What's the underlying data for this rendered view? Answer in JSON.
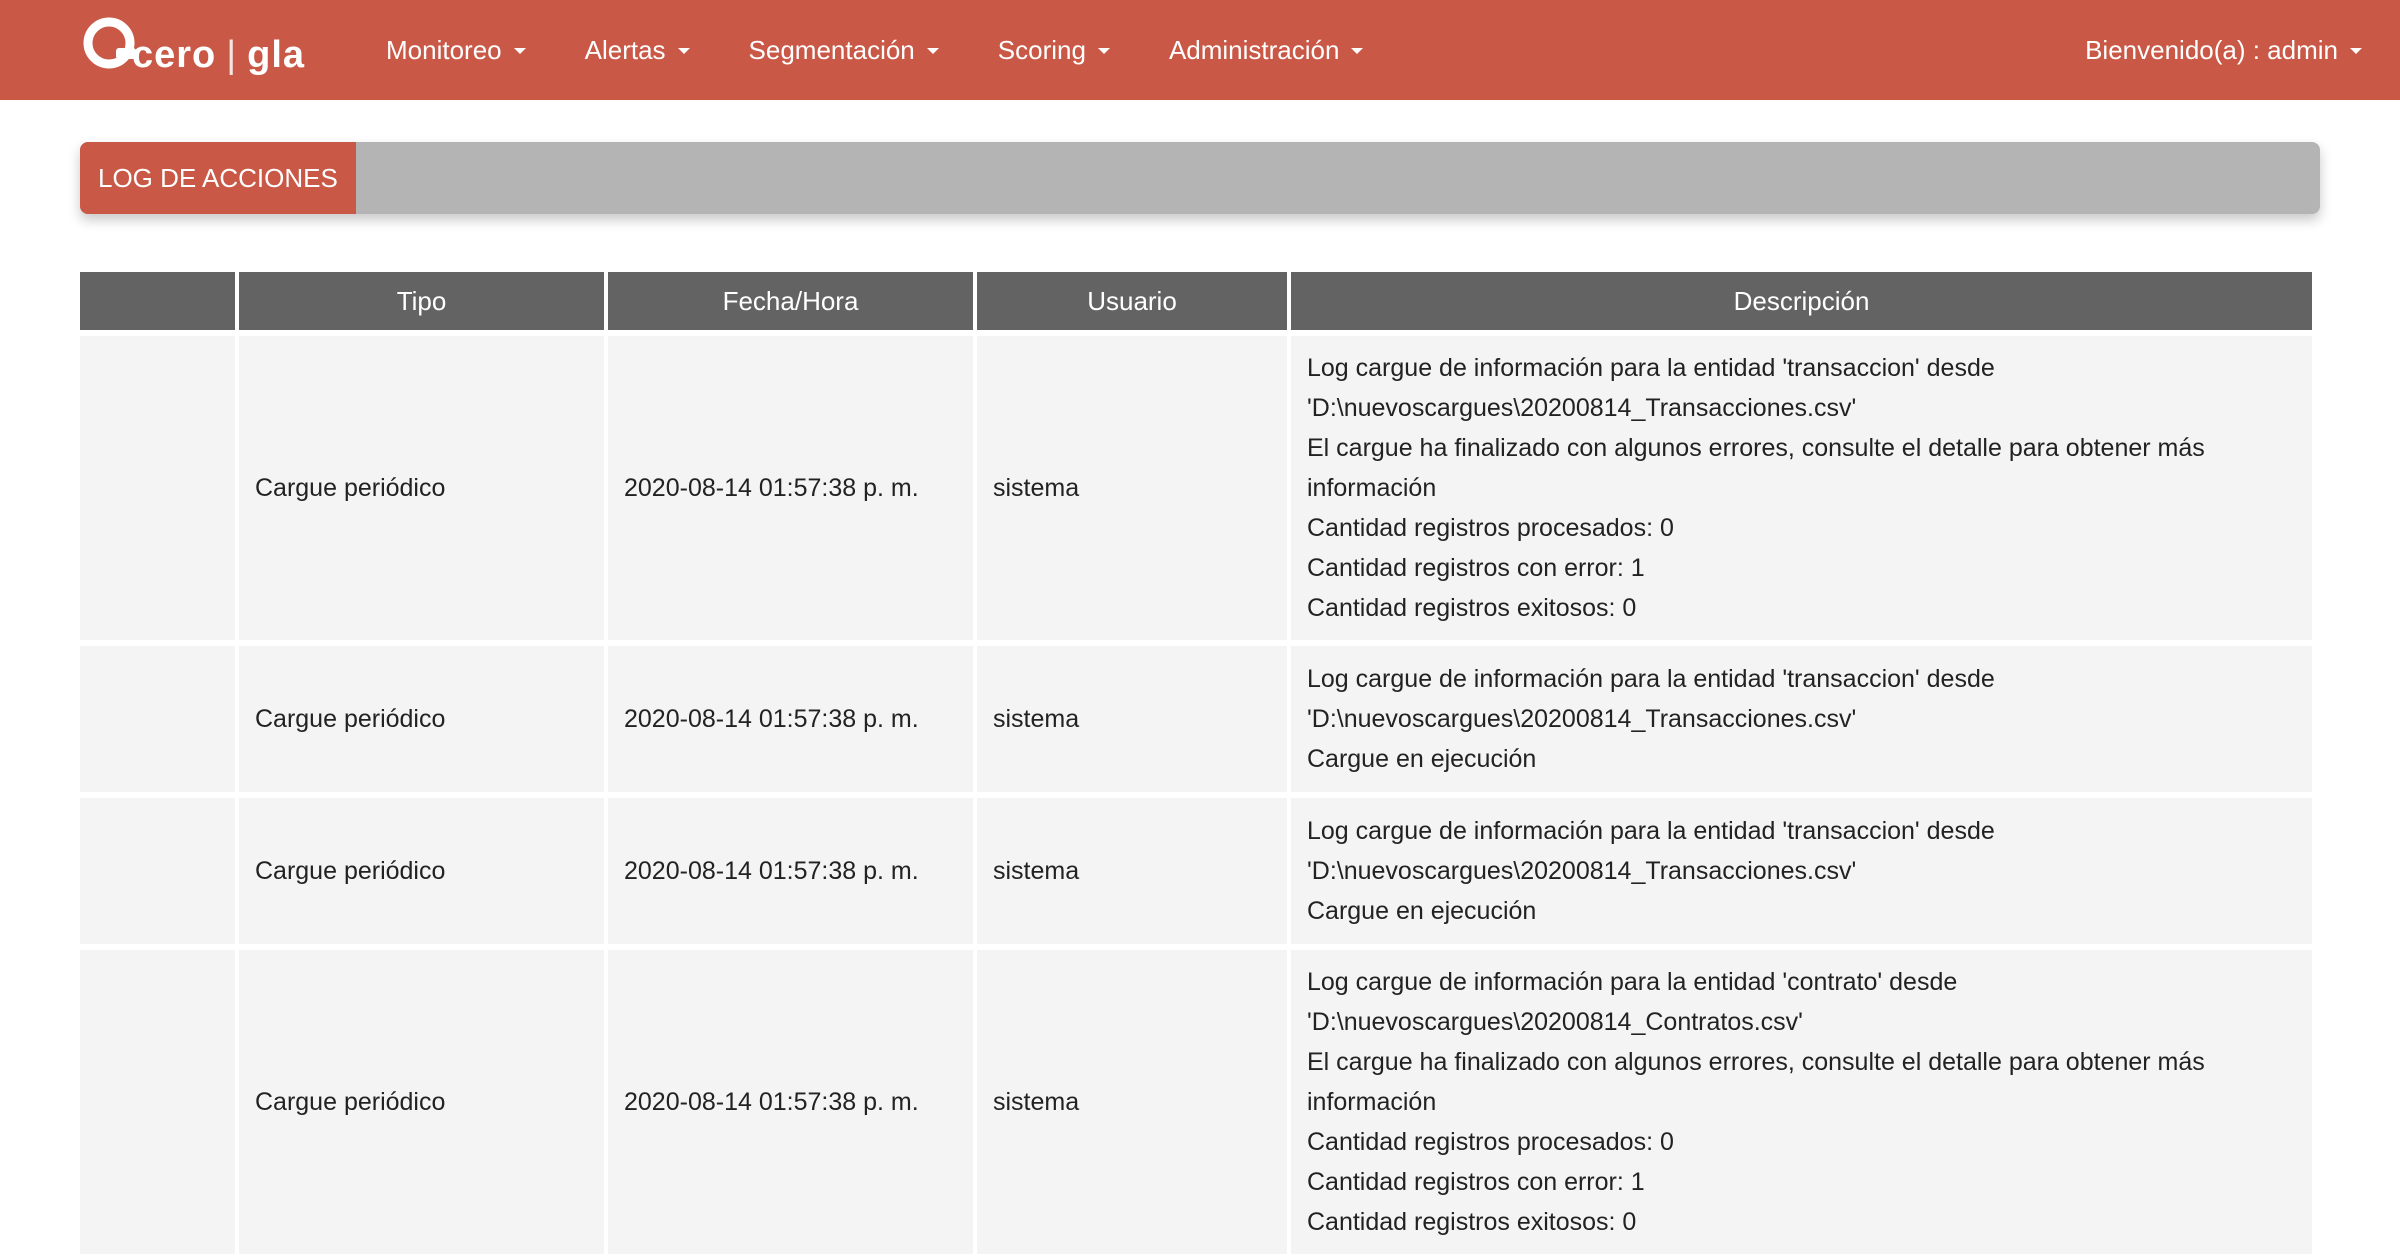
{
  "navbar": {
    "logo_text_a": "cero",
    "logo_sep": "|",
    "logo_text_b": "gla",
    "menu": [
      {
        "label": "Monitoreo"
      },
      {
        "label": "Alertas"
      },
      {
        "label": "Segmentación"
      },
      {
        "label": "Scoring"
      },
      {
        "label": "Administración"
      }
    ],
    "user_label": "Bienvenido(a) : admin",
    "brand_color": "#c95846"
  },
  "page": {
    "title": "LOG DE ACCIONES"
  },
  "table": {
    "columns": [
      "",
      "Tipo",
      "Fecha/Hora",
      "Usuario",
      "Descripción"
    ],
    "rows": [
      {
        "tipo": "Cargue periódico",
        "fecha": "2020-08-14 01:57:38 p. m.",
        "usuario": "sistema",
        "descripcion": [
          "Log cargue de información para la entidad 'transaccion' desde",
          "'D:\\nuevoscargues\\20200814_Transacciones.csv'",
          "El cargue ha finalizado con algunos errores, consulte el detalle para obtener más",
          "información",
          "Cantidad registros procesados: 0",
          "Cantidad registros con error: 1",
          "Cantidad registros exitosos: 0"
        ]
      },
      {
        "tipo": "Cargue periódico",
        "fecha": "2020-08-14 01:57:38 p. m.",
        "usuario": "sistema",
        "descripcion": [
          "Log cargue de información para la entidad 'transaccion' desde",
          "'D:\\nuevoscargues\\20200814_Transacciones.csv'",
          "Cargue en ejecución"
        ]
      },
      {
        "tipo": "Cargue periódico",
        "fecha": "2020-08-14 01:57:38 p. m.",
        "usuario": "sistema",
        "descripcion": [
          "Log cargue de información para la entidad 'transaccion' desde",
          "'D:\\nuevoscargues\\20200814_Transacciones.csv'",
          "Cargue en ejecución"
        ]
      },
      {
        "tipo": "Cargue periódico",
        "fecha": "2020-08-14 01:57:38 p. m.",
        "usuario": "sistema",
        "descripcion": [
          "Log cargue de información para la entidad 'contrato' desde",
          "'D:\\nuevoscargues\\20200814_Contratos.csv'",
          "El cargue ha finalizado con algunos errores, consulte el detalle para obtener más",
          "información",
          "Cantidad registros procesados: 0",
          "Cantidad registros con error: 1",
          "Cantidad registros exitosos: 0"
        ]
      }
    ]
  }
}
